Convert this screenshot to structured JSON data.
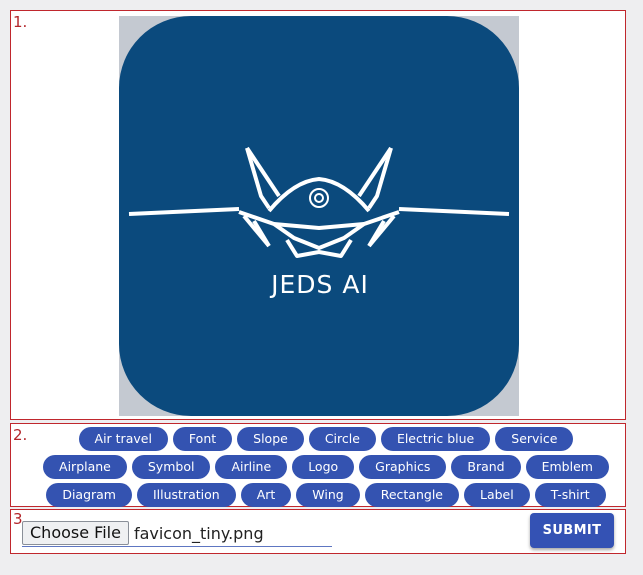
{
  "sections": {
    "image_number": "1.",
    "tags_number": "2.",
    "upload_number": "3."
  },
  "logo": {
    "text": "JEDS AI",
    "background_color": "#0b4a7d",
    "icon": "fighter-jet-logo"
  },
  "tags": [
    "Air travel",
    "Font",
    "Slope",
    "Circle",
    "Electric blue",
    "Service",
    "Airplane",
    "Symbol",
    "Airline",
    "Logo",
    "Graphics",
    "Brand",
    "Emblem",
    "Diagram",
    "Illustration",
    "Art",
    "Wing",
    "Rectangle",
    "Label",
    "T-shirt"
  ],
  "upload": {
    "choose_label": "Choose File",
    "file_name": "favicon_tiny.png",
    "submit_label": "SUBMIT"
  },
  "colors": {
    "accent": "#3453b1",
    "border": "#c0272d"
  }
}
